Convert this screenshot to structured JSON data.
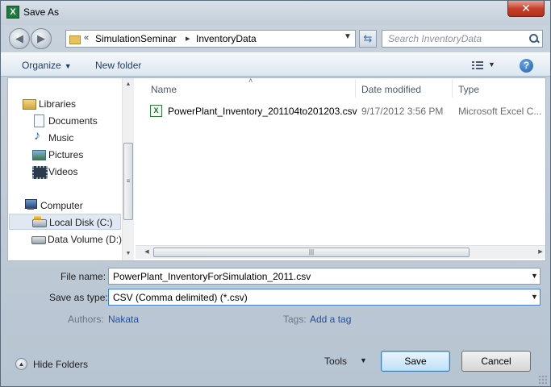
{
  "window": {
    "title": "Save As",
    "app_icon": "excel-icon",
    "close_label": "✕"
  },
  "address": {
    "overflow": "«",
    "crumbs": [
      "SimulationSeminar",
      "InventoryData"
    ],
    "separator": "▸"
  },
  "search": {
    "placeholder": "Search InventoryData"
  },
  "toolbar": {
    "organize": "Organize",
    "new_folder": "New folder",
    "help": "?"
  },
  "nav": {
    "items": [
      {
        "label": "Libraries",
        "icon": "libraries-icon"
      },
      {
        "label": "Documents",
        "icon": "documents-icon"
      },
      {
        "label": "Music",
        "icon": "music-icon"
      },
      {
        "label": "Pictures",
        "icon": "pictures-icon"
      },
      {
        "label": "Videos",
        "icon": "videos-icon"
      },
      {
        "label": "Computer",
        "icon": "computer-icon"
      },
      {
        "label": "Local Disk (C:)",
        "icon": "local-disk-icon",
        "selected": true
      },
      {
        "label": "Data Volume (D:)",
        "icon": "data-volume-icon"
      }
    ]
  },
  "columns": {
    "name": "Name",
    "date": "Date modified",
    "type": "Type"
  },
  "files": [
    {
      "name": "PowerPlant_Inventory_201104to201203.csv",
      "date": "9/17/2012 3:56 PM",
      "type": "Microsoft Excel C..."
    }
  ],
  "form": {
    "file_name_label": "File name:",
    "file_name_value": "PowerPlant_InventoryForSimulation_2011.csv",
    "save_type_label": "Save as type:",
    "save_type_value": "CSV (Comma delimited) (*.csv)",
    "authors_label": "Authors:",
    "authors_value": "Nakata",
    "tags_label": "Tags:",
    "tags_value": "Add a tag"
  },
  "footer": {
    "hide_folders": "Hide Folders",
    "tools": "Tools",
    "save": "Save",
    "cancel": "Cancel"
  },
  "colors": {
    "accent": "#3d7bd6",
    "link": "#1f4f9e",
    "close": "#c6422d"
  }
}
